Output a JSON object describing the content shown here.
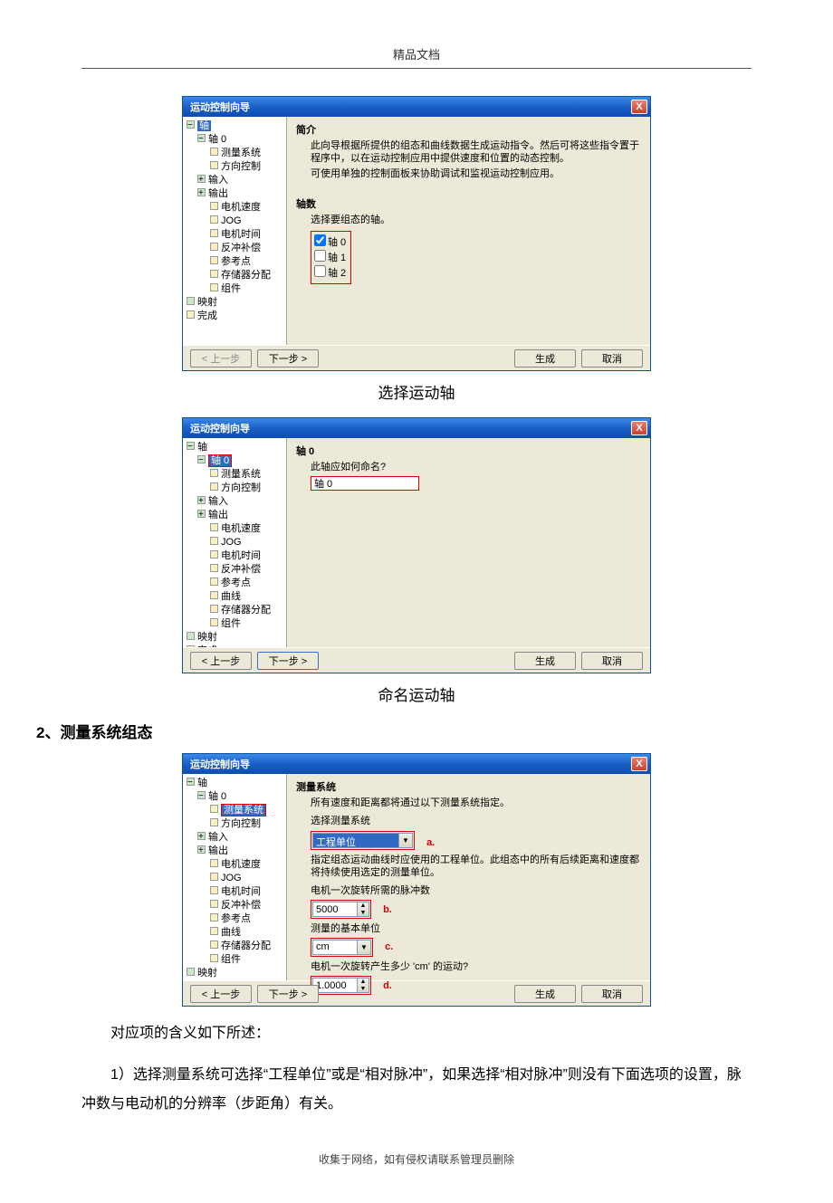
{
  "header": "精品文档",
  "dialog_title": "运动控制向导",
  "close_x": "X",
  "tree": {
    "root": "轴",
    "axis0": "轴 0",
    "items": [
      "测量系统",
      "方向控制",
      "输入",
      "输出",
      "电机速度",
      "JOG",
      "电机时间",
      "反冲补偿",
      "参考点",
      "曲线",
      "存储器分配",
      "组件"
    ],
    "mapping": "映射",
    "done": "完成"
  },
  "d1": {
    "h1": "简介",
    "p1": "此向导根据所提供的组态和曲线数据生成运动指令。然后可将这些指令置于程序中，以在运动控制应用中提供速度和位置的动态控制。",
    "p2": "可使用单独的控制面板来协助调试和监视运动控制应用。",
    "h2": "轴数",
    "p3": "选择要组态的轴。",
    "chk": [
      "轴 0",
      "轴 1",
      "轴 2"
    ]
  },
  "d2": {
    "h1": "轴 0",
    "p1": "此轴应如何命名?",
    "val": "轴 0"
  },
  "d3": {
    "h1": "测量系统",
    "p1": "所有速度和距离都将通过以下测量系统指定。",
    "p2": "选择测量系统",
    "combo1": "工程单位",
    "p3": "指定组态运动曲线时应使用的工程单位。此组态中的所有后续距离和速度都将持续使用选定的测量单位。",
    "p4": "电机一次旋转所需的脉冲数",
    "v4": "5000",
    "p5": "测量的基本单位",
    "v5": "cm",
    "p6": "电机一次旋转产生多少 'cm' 的运动?",
    "v6": "1.0000",
    "a": "a.",
    "b": "b.",
    "c": "c.",
    "d": "d."
  },
  "buttons": {
    "prev": "< 上一步",
    "next": "下一步 >",
    "gen": "生成",
    "cancel": "取消"
  },
  "captions": {
    "c1": "选择运动轴",
    "c2": "命名运动轴"
  },
  "section2": "2、测量系统组态",
  "body1": "对应项的含义如下所述：",
  "body2": "1）选择测量系统可选择“工程单位”或是“相对脉冲”，如果选择“相对脉冲”则没有下面选项的设置，脉冲数与电动机的分辨率（步距角）有关。",
  "footer": "收集于网络，如有侵权请联系管理员删除"
}
